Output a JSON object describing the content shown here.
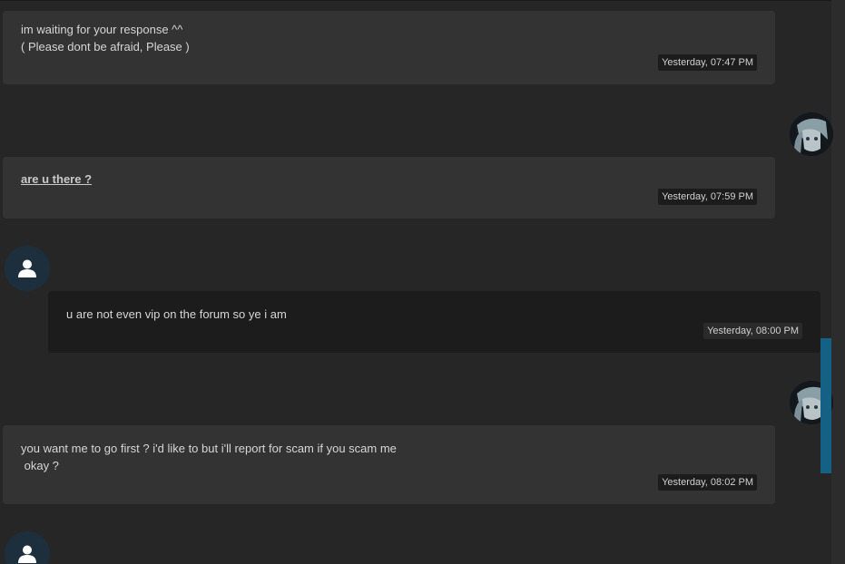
{
  "messages": [
    {
      "text": "im waiting for your response ^^\n( Please dont be afraid, Please )",
      "time": "Yesterday, 07:47 PM"
    },
    {
      "text": "are u there ?",
      "time": "Yesterday, 07:59 PM"
    },
    {
      "text": "u are not even vip on the forum so ye i am",
      "time": "Yesterday, 08:00 PM"
    },
    {
      "text": "you want me to go first ? i'd like to but i'll report for scam if you scam me\n okay ?",
      "time": "Yesterday, 08:02 PM"
    }
  ],
  "icons": {
    "sender_avatar": "anime-avatar",
    "receiver_avatar": "user-icon"
  },
  "colors": {
    "background": "#262626",
    "outgoing_bubble": "#333333",
    "incoming_bubble": "#1c1c1c",
    "avatar_circle": "#1d2f3d",
    "scrollbar_thumb": "#146185"
  }
}
